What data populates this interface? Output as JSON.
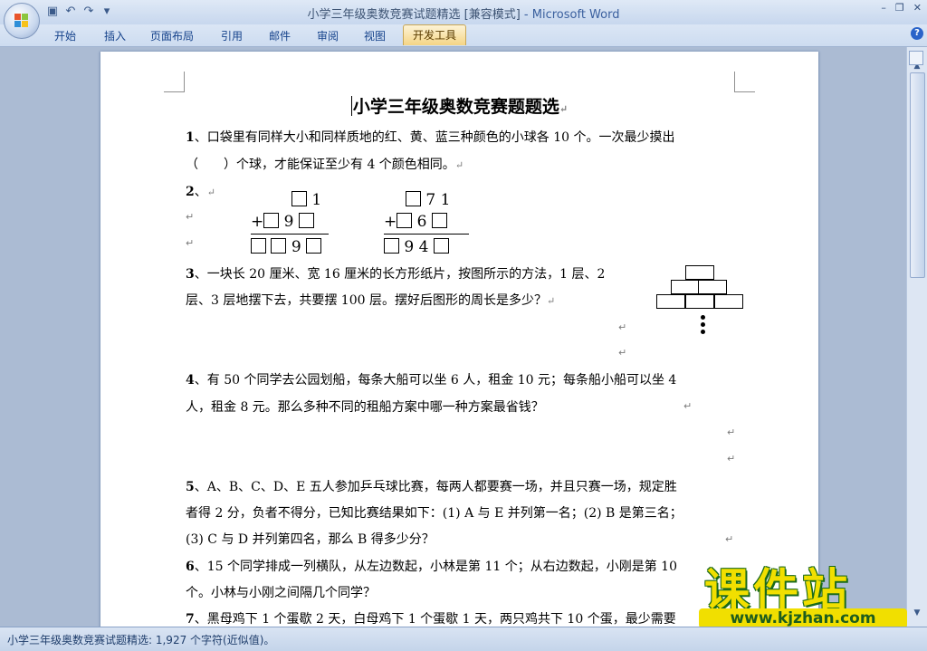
{
  "window": {
    "title": "小学三年级奥数竞赛试题精选 [兼容模式]",
    "app_name": " - Microsoft Word",
    "controls": [
      "–",
      "❐",
      "✕"
    ]
  },
  "quick_access": {
    "save_icon": "save-icon",
    "undo_icon": "undo-icon",
    "redo_icon": "redo-icon",
    "customize_icon": "customize-icon"
  },
  "ribbon": {
    "tabs": [
      {
        "label": "开始"
      },
      {
        "label": "插入"
      },
      {
        "label": "页面布局"
      },
      {
        "label": "引用"
      },
      {
        "label": "邮件"
      },
      {
        "label": "审阅"
      },
      {
        "label": "视图"
      },
      {
        "label": "开发工具"
      }
    ],
    "active_tab": "开发工具",
    "help": "?"
  },
  "document": {
    "title": "小学三年级奥数竞赛题题选",
    "para_mark": "↵",
    "q1": {
      "num": "1",
      "line1": "、口袋里有同样大小和同样质地的红、黄、蓝三种颜色的小球各 10 个。一次最少摸出",
      "line2": "（　　）个球，才能保证至少有 4 个颜色相同。"
    },
    "q2": {
      "num": "2",
      "label": "、",
      "p1": {
        "top": "1",
        "plus": "+",
        "mid": "9",
        "bottom": "9"
      },
      "p2": {
        "top_a": "7",
        "top_b": "1",
        "plus": "+",
        "mid": "6",
        "bottom_a": "9",
        "bottom_b": "4"
      }
    },
    "q3": {
      "num": "3",
      "line1": "、一块长 20 厘米、宽 16 厘米的长方形纸片，按图所示的方法，1 层、2",
      "line2": "层、3 层地摆下去，共要摆 100 层。摆好后图形的周长是多少？"
    },
    "q4": {
      "num": "4",
      "line1": "、有 50 个同学去公园划船，每条大船可以坐 6 人，租金 10 元；每条船小船可以坐 4",
      "line2": "人，租金 8 元。那么多种不同的租船方案中哪一种方案最省钱？"
    },
    "q5": {
      "num": "5",
      "line1": "、A、B、C、D、E 五人参加乒乓球比赛，每两人都要赛一场，并且只赛一场，规定胜",
      "line2": "者得 2 分，负者不得分，已知比赛结果如下：(1) A 与 E 并列第一名；(2) B 是第三名；",
      "line3": "(3) C 与 D 并列第四名，那么 B 得多少分？"
    },
    "q6": {
      "num": "6",
      "line1": "、15 个同学排成一列横队，从左边数起，小林是第 11 个；从右边数起，小刚是第 10",
      "line2": "个。小林与小刚之间隔几个同学？"
    },
    "q7": {
      "num": "7",
      "line1": "、黑母鸡下 1 个蛋歇 2 天，白母鸡下 1 个蛋歇 1 天，两只鸡共下 10 个蛋，最少需要"
    }
  },
  "status": {
    "text": "小学三年级奥数竞赛试题精选: 1,927 个字符(近似值)。"
  },
  "watermark": {
    "main": "课件站",
    "url": "www.kjzhan.com"
  }
}
